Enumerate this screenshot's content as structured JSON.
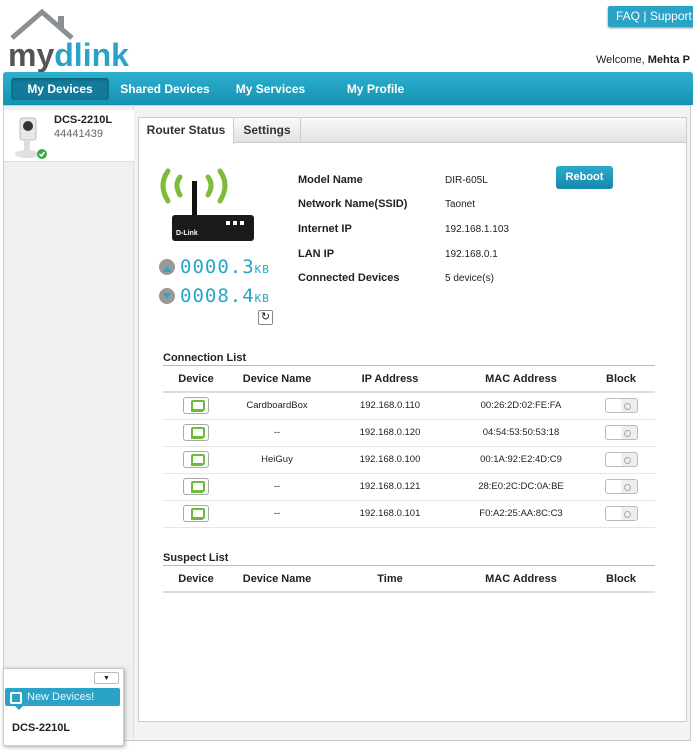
{
  "header": {
    "logo": "mydlink",
    "faq": "FAQ",
    "separator": "|",
    "support": "Support",
    "welcome_prefix": "Welcome,",
    "user": "Mehta P"
  },
  "nav": [
    "My Devices",
    "Shared Devices",
    "My Services",
    "My Profile"
  ],
  "sidebar": {
    "device_name": "DCS-2210L",
    "device_id": "44441439"
  },
  "tabs": [
    "Router Status",
    "Settings"
  ],
  "router": {
    "brand": "D-Link",
    "info": [
      {
        "label": "Model Name",
        "value": "DIR-605L"
      },
      {
        "label": "Network Name(SSID)",
        "value": "Taonet"
      },
      {
        "label": "Internet IP",
        "value": "192.168.1.103"
      },
      {
        "label": "LAN IP",
        "value": "192.168.0.1"
      },
      {
        "label": "Connected Devices",
        "value": "5 device(s)"
      }
    ],
    "reboot": "Reboot",
    "upload": "0000.3",
    "download": "0008.4",
    "unit": "KB"
  },
  "connection_list": {
    "title": "Connection List",
    "headers": [
      "Device",
      "Device Name",
      "IP Address",
      "MAC Address",
      "Block"
    ],
    "rows": [
      {
        "name": "CardboardBox",
        "ip": "192.168.0.110",
        "mac": "00:26:2D:02:FE:FA"
      },
      {
        "name": "--",
        "ip": "192.168.0.120",
        "mac": "04:54:53:50:53:18"
      },
      {
        "name": "HeiGuy",
        "ip": "192.168.0.100",
        "mac": "00:1A:92:E2:4D:C9"
      },
      {
        "name": "--",
        "ip": "192.168.0.121",
        "mac": "28:E0:2C:DC:0A:BE"
      },
      {
        "name": "--",
        "ip": "192.168.0.101",
        "mac": "F0:A2:25:AA:8C:C3"
      }
    ]
  },
  "suspect_list": {
    "title": "Suspect List",
    "headers": [
      "Device",
      "Device Name",
      "Time",
      "MAC Address",
      "Block"
    ]
  },
  "popup": {
    "banner": "New Devices!",
    "device": "DCS-2210L"
  },
  "colors": {
    "accent": "#2aa3c7",
    "green": "#6dbb3c"
  }
}
